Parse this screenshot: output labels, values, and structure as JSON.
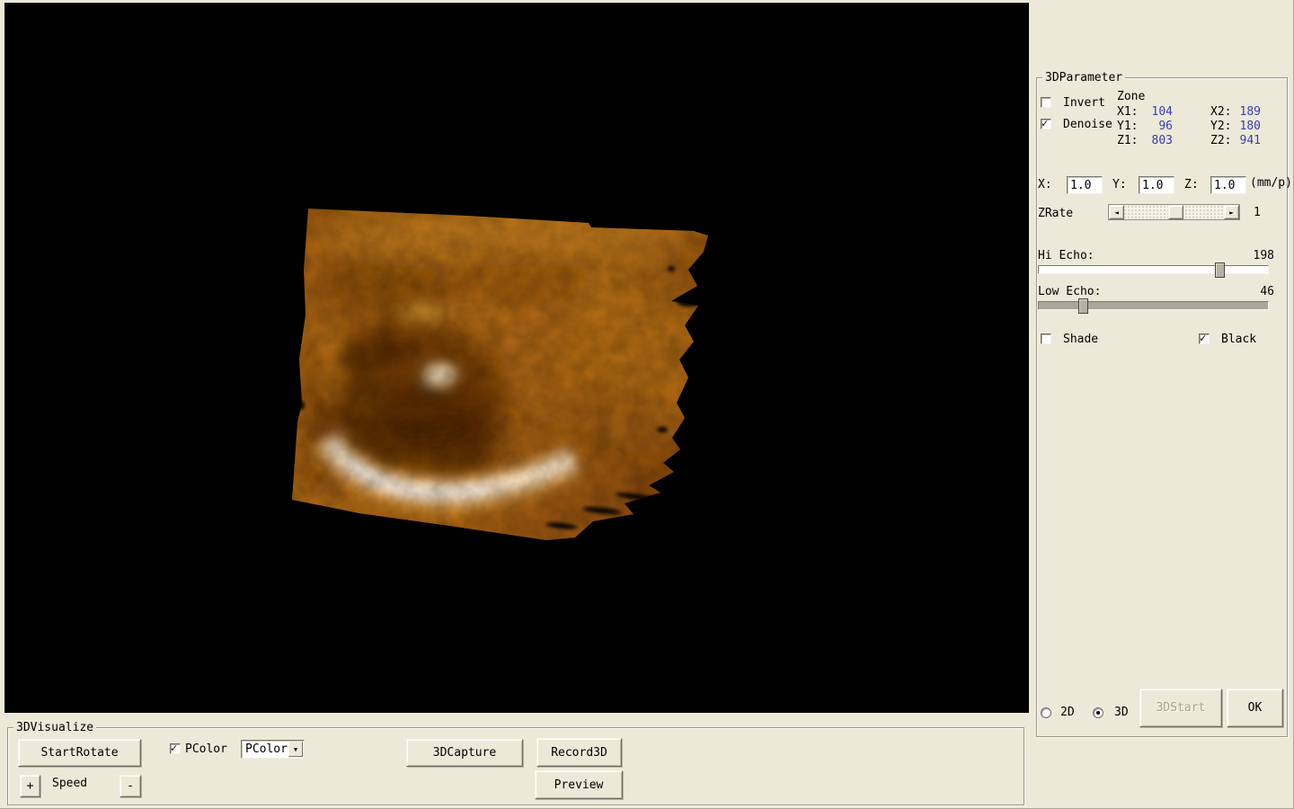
{
  "param_panel": {
    "title": "3DParameter",
    "invert": {
      "label": "Invert",
      "checked": false
    },
    "denoise": {
      "label": "Denoise",
      "checked": true
    },
    "zone": {
      "title": "Zone",
      "rows": [
        {
          "l1": "X1:",
          "v1": "104",
          "l2": "X2:",
          "v2": "189"
        },
        {
          "l1": "Y1:",
          "v1": "96",
          "l2": "Y2:",
          "v2": "180"
        },
        {
          "l1": "Z1:",
          "v1": "803",
          "l2": "Z2:",
          "v2": "941"
        }
      ]
    },
    "scale": {
      "x_label": "X:",
      "x_value": "1.0",
      "y_label": "Y:",
      "y_value": "1.0",
      "z_label": "Z:",
      "z_value": "1.0",
      "unit": "(mm/p)"
    },
    "zrate": {
      "label": "ZRate",
      "value": "1"
    },
    "hi_echo": {
      "label": "Hi Echo:",
      "value": "198",
      "range_max": 255
    },
    "low_echo": {
      "label": "Low Echo:",
      "value": "46",
      "range_max": 255
    },
    "shade": {
      "label": "Shade",
      "checked": false
    },
    "black": {
      "label": "Black",
      "checked": true
    },
    "mode_2d": {
      "label": "2D",
      "selected": false
    },
    "mode_3d": {
      "label": "3D",
      "selected": true
    },
    "start_button": {
      "label": "3DStart",
      "disabled": true
    },
    "ok_button": {
      "label": "OK"
    }
  },
  "visualize_panel": {
    "title": "3DVisualize",
    "start_rotate_button": "StartRotate",
    "speed": {
      "plus": "+",
      "label": "Speed",
      "minus": "-"
    },
    "pcolor_check": {
      "label": "PColor",
      "checked": true
    },
    "pcolor_dropdown": {
      "value": "PColor"
    },
    "capture_button": "3DCapture",
    "record_button": "Record3D",
    "preview_button": "Preview"
  },
  "colors": {
    "window_bg": "#ece9d8",
    "viewport_bg": "#000000",
    "value_text": "#3c3cb4",
    "render_amber": "#b06a15",
    "render_highlight": "#fff6e0"
  }
}
